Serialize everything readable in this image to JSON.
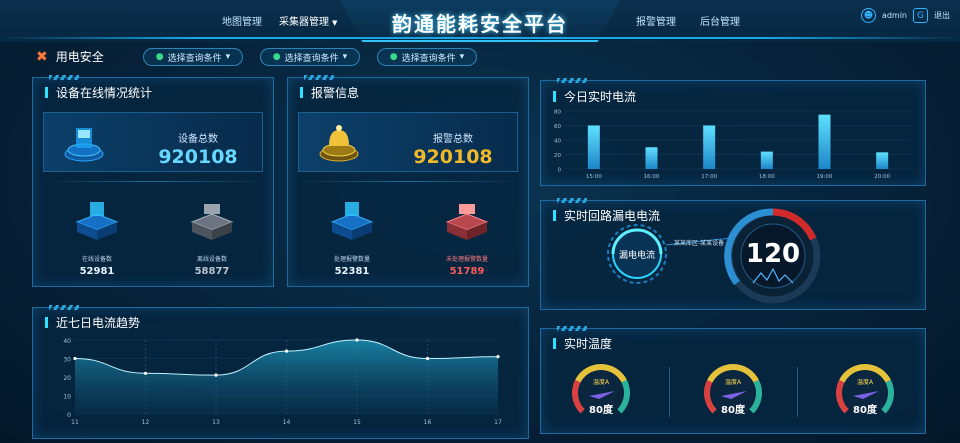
{
  "header": {
    "title": "韵通能耗安全平台",
    "nav_left": [
      "地图管理",
      "采集器管理"
    ],
    "nav_right": [
      "报警管理",
      "后台管理"
    ],
    "user": "admin",
    "logout": "退出"
  },
  "toolbar": {
    "module": "用电安全",
    "filters": [
      "选择查询条件",
      "选择查询条件",
      "选择查询条件"
    ]
  },
  "devices": {
    "title": "设备在线情况统计",
    "total_label": "设备总数",
    "total": "920108",
    "online_label": "在线设备数",
    "online": "52981",
    "offline_label": "离线设备数",
    "offline": "58877"
  },
  "alarms": {
    "title": "报警信息",
    "total_label": "报警总数",
    "total": "920108",
    "handled_label": "处理报警数量",
    "handled": "52381",
    "unhandled_label": "未处理报警数量",
    "unhandled": "51789"
  },
  "trend": {
    "title": "近七日电流趋势",
    "chart_data": {
      "type": "area",
      "x": [
        "11",
        "12",
        "13",
        "14",
        "15",
        "16",
        "17"
      ],
      "values": [
        30,
        22,
        21,
        34,
        40,
        30,
        31
      ],
      "ylim": [
        0,
        40
      ],
      "yticks": [
        "40",
        "30",
        "20",
        "10",
        "0"
      ],
      "grid": true
    }
  },
  "realtime": {
    "title": "今日实时电流",
    "chart_data": {
      "type": "bar",
      "categories": [
        "15:00",
        "16:00",
        "17:00",
        "18:00",
        "19:00",
        "20:00"
      ],
      "values": [
        60,
        30,
        60,
        24,
        75,
        23
      ],
      "ylim": [
        0,
        80
      ],
      "yticks": [
        "80",
        "60",
        "40",
        "20",
        "0"
      ]
    }
  },
  "leakage": {
    "title": "实时回路漏电电流",
    "ring_label": "漏电电流",
    "location": "某某库区-某某设备",
    "value": "120"
  },
  "temperature": {
    "title": "实时温度",
    "gauges": [
      {
        "label": "温度A",
        "value": "80度"
      },
      {
        "label": "温度A",
        "value": "80度"
      },
      {
        "label": "温度A",
        "value": "80度"
      }
    ]
  },
  "colors": {
    "accent": "#2ee3ff",
    "gold": "#f0b92a",
    "red": "#ff5a5a",
    "panel_border": "#1d6aa0"
  }
}
